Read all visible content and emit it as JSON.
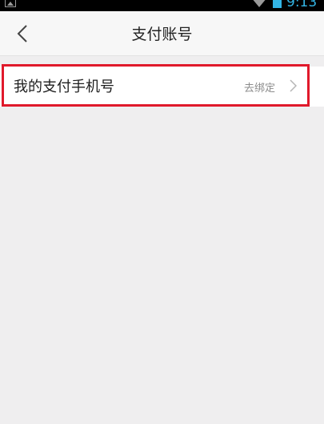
{
  "status_bar": {
    "time": "9:13",
    "icons": [
      "image-icon",
      "wifi-icon",
      "battery-icon"
    ],
    "accent_color": "#33b5e5"
  },
  "nav_bar": {
    "title": "支付账号",
    "back_icon": "chevron-left-icon"
  },
  "payment_accounts": {
    "items": [
      {
        "label": "我的支付手机号",
        "action_label": "去绑定",
        "trailing_icon": "chevron-right-icon",
        "highlighted": true,
        "highlight_color": "#e0192b"
      }
    ]
  },
  "colors": {
    "background": "#efeeef",
    "nav_background": "#f7f7f7",
    "row_background": "#ffffff"
  }
}
